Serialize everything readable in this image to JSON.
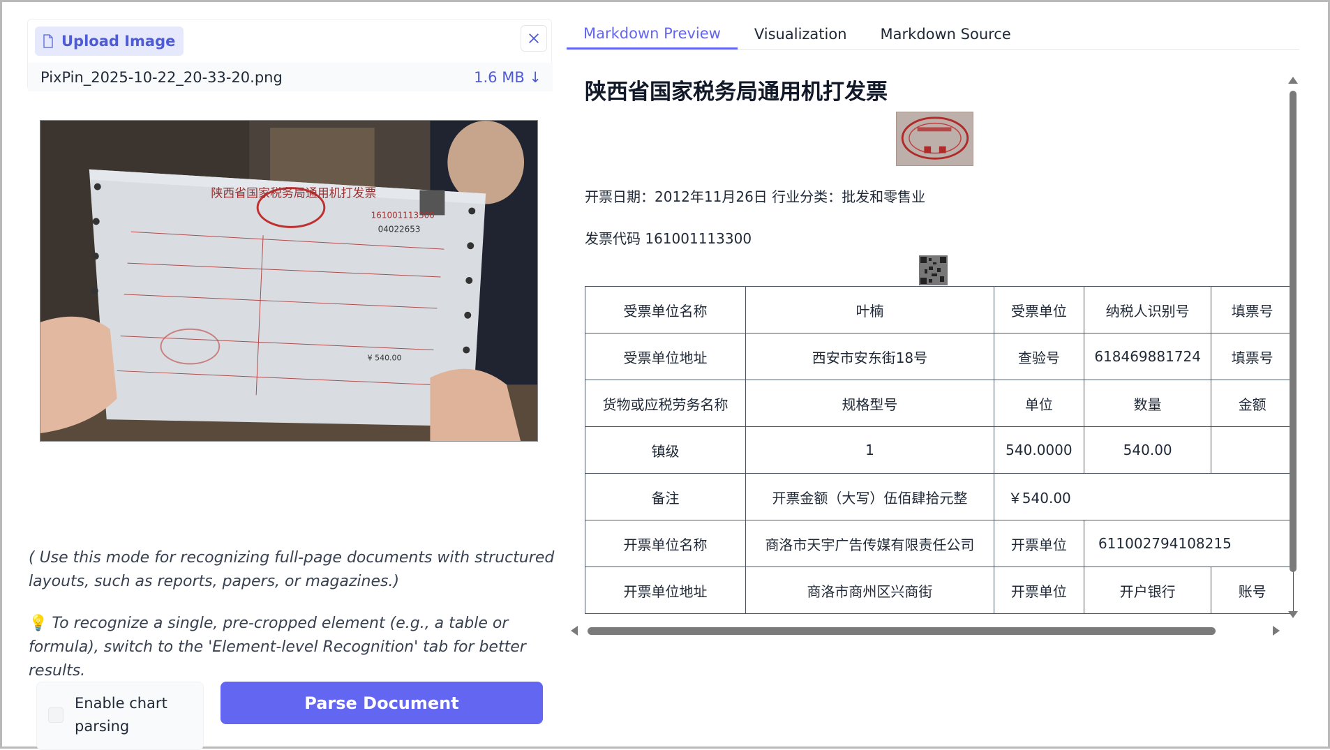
{
  "upload": {
    "button_label": "Upload Image",
    "file_name": "PixPin_2025-10-22_20-33-20.png",
    "file_size": "1.6 MB ↓"
  },
  "photo": {
    "invoice_header": "陕西省国家税务局通用机打发票",
    "invoice_code": "161001113300",
    "invoice_number": "04022653",
    "amount": "¥ 540.00"
  },
  "hints": {
    "mode_text": "( Use this mode for recognizing full-page documents with structured layouts, such as reports, papers, or magazines.)",
    "element_text": "To recognize a single, pre-cropped element (e.g., a table or formula), switch to the 'Element-level Recognition' tab for better results."
  },
  "controls": {
    "chart_parsing_label": "Enable chart parsing",
    "parse_button": "Parse Document"
  },
  "tabs": [
    {
      "label": "Markdown Preview",
      "active": true
    },
    {
      "label": "Visualization",
      "active": false
    },
    {
      "label": "Markdown Source",
      "active": false
    }
  ],
  "preview": {
    "title": "陕西省国家税务局通用机打发票",
    "date_line": "开票日期：2012年11月26日 行业分类：批发和零售业",
    "code_line": "发票代码 161001113300",
    "table": [
      [
        "受票单位名称",
        "叶楠",
        "受票单位",
        "纳税人识别号",
        "填票号"
      ],
      [
        "受票单位地址",
        "西安市安东街18号",
        "查验号",
        "618469881724",
        "填票号"
      ],
      [
        "货物或应税劳务名称",
        "规格型号",
        "单位",
        "数量",
        "金额"
      ],
      [
        "镇级",
        "1",
        "540.0000",
        "540.00",
        ""
      ],
      [
        "备注",
        "开票金额（大写）伍佰肆拾元整",
        "￥540.00"
      ],
      [
        "开票单位名称",
        "商洛市天宇广告传媒有限责任公司",
        "开票单位",
        "611002794108215"
      ],
      [
        "开票单位地址",
        "商洛市商州区兴商街",
        "开票单位",
        "开户银行",
        "账号"
      ]
    ]
  },
  "colors": {
    "accent": "#6366f1",
    "accent_light": "#e5e9fb"
  }
}
